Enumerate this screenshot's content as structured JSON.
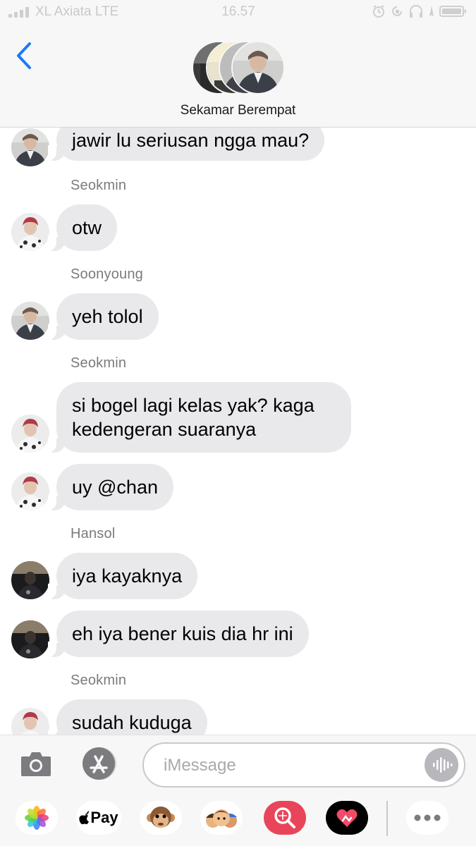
{
  "status_bar": {
    "carrier": "XL Axiata LTE",
    "time": "16.57",
    "signal_bars": 4
  },
  "header": {
    "back_icon": "chevron-left-icon",
    "group_name": "Sekamar Berempat"
  },
  "messages": [
    {
      "sender": "",
      "text": "jawir lu seriusan ngga mau?",
      "avatar": "avatar-dark-jacket"
    },
    {
      "sender": "Seokmin",
      "text": "otw",
      "avatar": "avatar-pink-hair"
    },
    {
      "sender": "Soonyoung",
      "text": "yeh tolol",
      "avatar": "avatar-dark-jacket"
    },
    {
      "sender": "Seokmin",
      "text": "si bogel lagi kelas yak? kaga kedengeran suaranya",
      "avatar": "avatar-pink-hair"
    },
    {
      "sender": "",
      "text": "uy @chan",
      "avatar": "avatar-pink-hair"
    },
    {
      "sender": "Hansol",
      "text": "iya kayaknya",
      "avatar": "avatar-dark-photo"
    },
    {
      "sender": "",
      "text": "eh iya bener kuis dia hr ini",
      "avatar": "avatar-dark-photo"
    },
    {
      "sender": "Seokmin",
      "text": "sudah kuduga",
      "avatar": "avatar-pink-hair"
    }
  ],
  "compose": {
    "camera_icon": "camera-icon",
    "apps_icon": "app-store-icon",
    "placeholder": "iMessage",
    "value": "",
    "audio_icon": "audio-waveform-icon"
  },
  "app_drawer": {
    "items": [
      {
        "name": "photos-app-icon"
      },
      {
        "name": "apple-pay-icon",
        "label": "Pay"
      },
      {
        "name": "animoji-monkey-icon"
      },
      {
        "name": "memoji-stickers-icon"
      },
      {
        "name": "image-search-icon"
      },
      {
        "name": "digital-touch-icon"
      },
      {
        "name": "more-apps-icon"
      }
    ]
  },
  "colors": {
    "bubble_gray": "#e9e9eb",
    "ios_blue": "#1a7cf5",
    "sender_gray": "#7b7b7f",
    "header_bg": "#f7f7f7"
  }
}
